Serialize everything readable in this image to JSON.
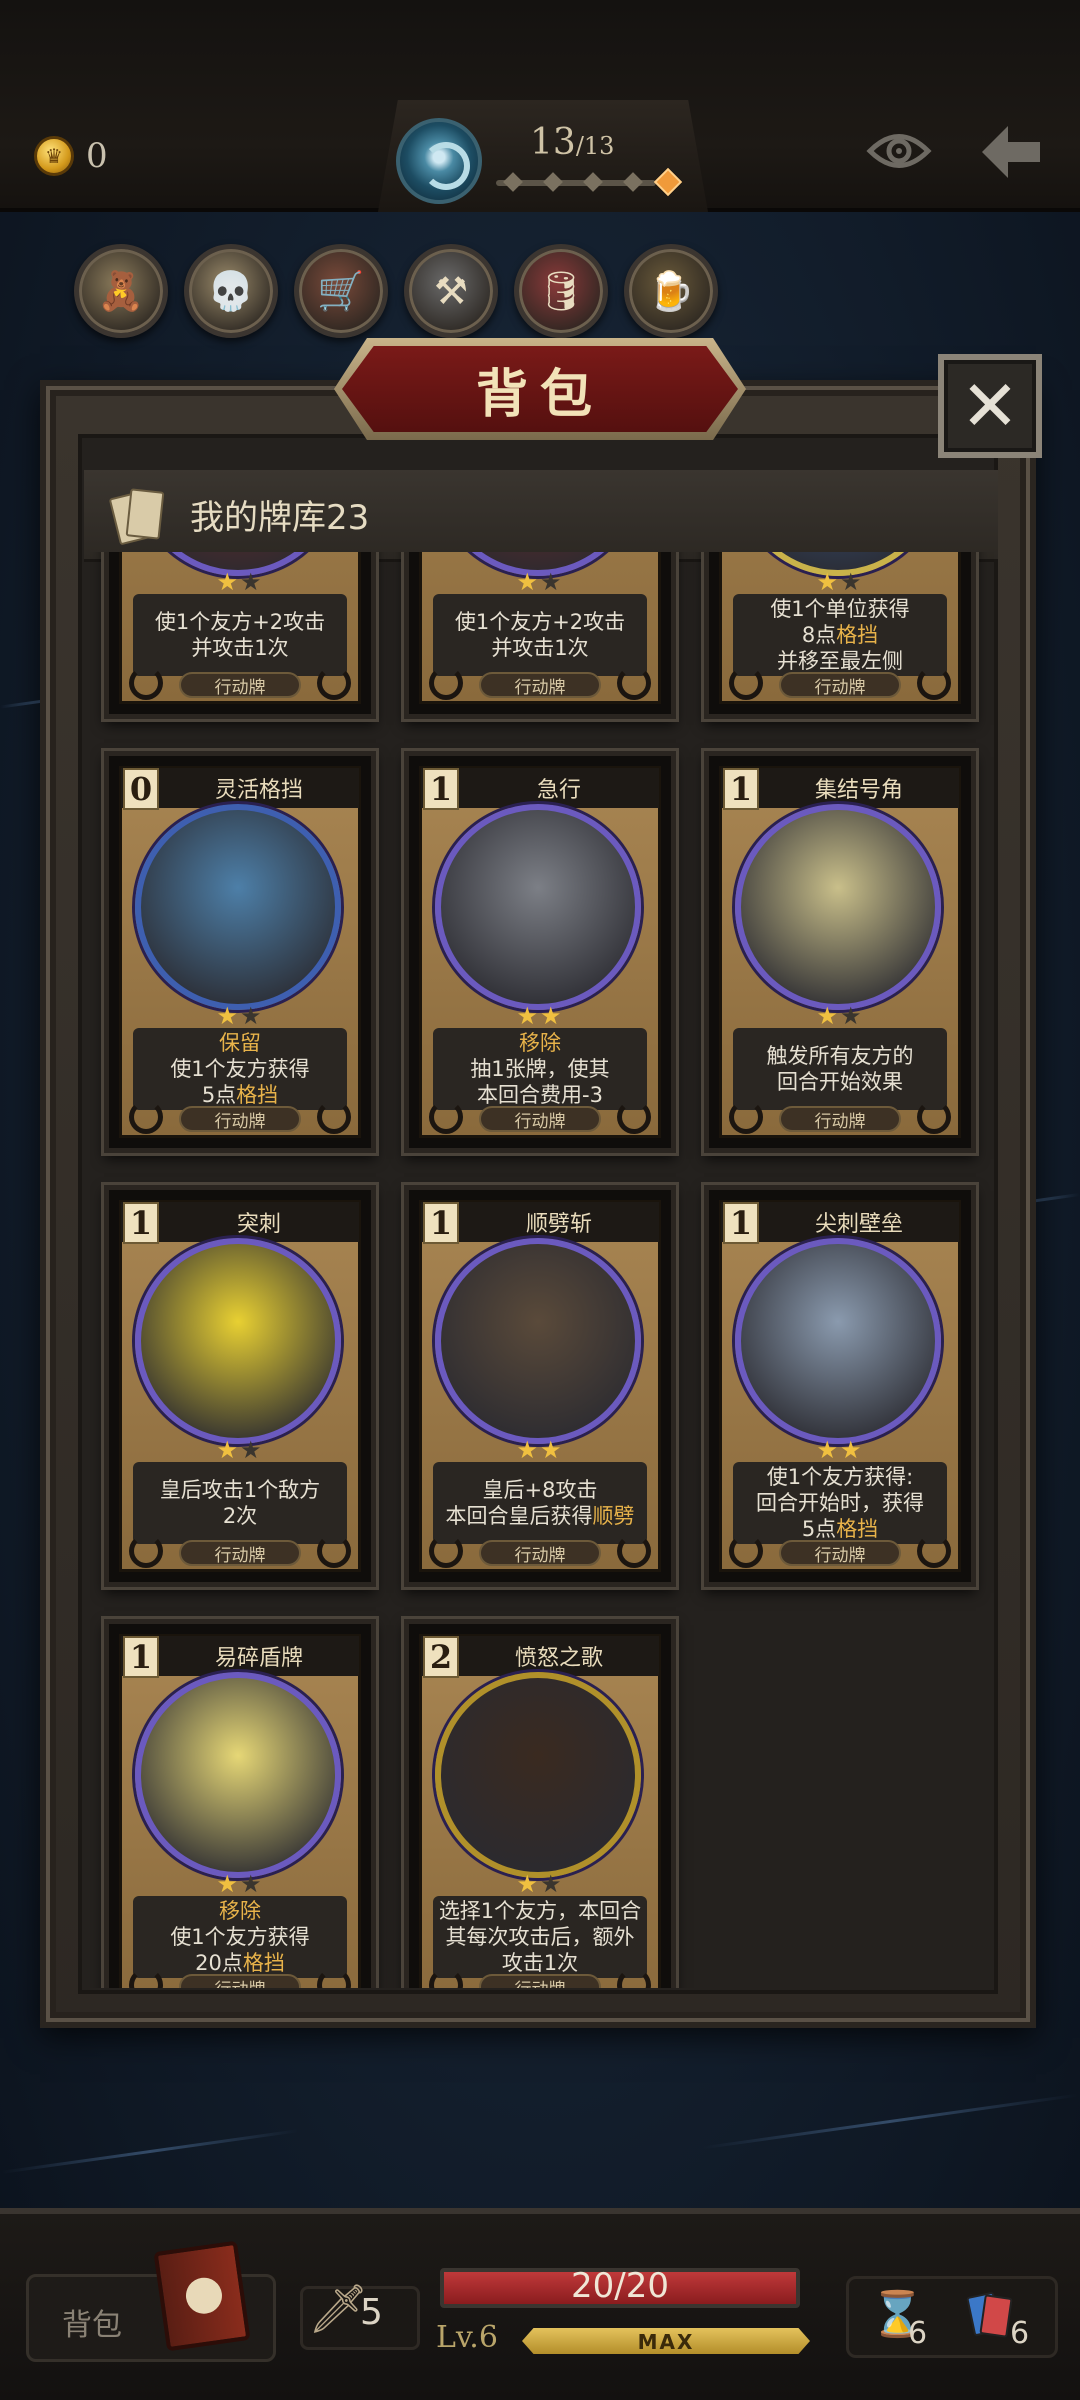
{
  "top_bar": {
    "gold": "0",
    "stage_current": "13",
    "stage_total": "/13",
    "stage_progress": 1.0
  },
  "relics": [
    {
      "name": "relic-scarecrow",
      "glyph": "🧸"
    },
    {
      "name": "relic-skeleton",
      "glyph": "💀"
    },
    {
      "name": "relic-wagon",
      "glyph": "🛒"
    },
    {
      "name": "relic-anvil",
      "glyph": "⚒"
    },
    {
      "name": "relic-barrels",
      "glyph": "🛢"
    },
    {
      "name": "relic-cauldron",
      "glyph": "🍺"
    }
  ],
  "panel": {
    "title": "背包",
    "close_label": "✕",
    "deck_title": "我的牌库23"
  },
  "cards": [
    {
      "cost": "",
      "name": "",
      "stars": 1,
      "lines": [
        "使1个友方+2攻击",
        "并攻击1次"
      ],
      "keyword": "",
      "type": "行动牌",
      "ring": "#6b5abf",
      "art": "#7a2a24"
    },
    {
      "cost": "",
      "name": "",
      "stars": 1,
      "lines": [
        "使1个友方+2攻击",
        "并攻击1次"
      ],
      "keyword": "",
      "type": "行动牌",
      "ring": "#6b5abf",
      "art": "#7a2a24"
    },
    {
      "cost": "",
      "name": "",
      "stars": 1,
      "lines": [
        "使1个单位获得",
        "8点格挡",
        "并移至最左侧"
      ],
      "keyword": "",
      "type": "行动牌",
      "ring": "#c9b24a",
      "art": "#3a5a8a"
    },
    {
      "cost": "0",
      "name": "灵活格挡",
      "stars": 1,
      "keyword": "保留",
      "lines": [
        "使1个友方获得",
        "5点格挡"
      ],
      "type": "行动牌",
      "ring": "#3e5fb0",
      "art": "#4d7fa8"
    },
    {
      "cost": "1",
      "name": "急行",
      "stars": 2,
      "keyword": "移除",
      "lines": [
        "抽1张牌，使其",
        "本回合费用-3"
      ],
      "type": "行动牌",
      "ring": "#6b5abf",
      "art": "#7c7f86"
    },
    {
      "cost": "1",
      "name": "集结号角",
      "stars": 1,
      "keyword": "",
      "lines": [
        "触发所有友方的",
        "回合开始效果"
      ],
      "type": "行动牌",
      "ring": "#6b5abf",
      "art": "#c9bf8a"
    },
    {
      "cost": "1",
      "name": "突刺",
      "stars": 1,
      "keyword": "",
      "lines": [
        "皇后攻击1个敌方",
        "2次"
      ],
      "type": "行动牌",
      "ring": "#6b5abf",
      "art": "#e8d032"
    },
    {
      "cost": "1",
      "name": "顺劈斩",
      "stars": 2,
      "keyword": "",
      "lines": [
        "皇后+8攻击",
        "本回合皇后获得顺劈"
      ],
      "type": "行动牌",
      "ring": "#6b5abf",
      "art": "#5a4a3a"
    },
    {
      "cost": "1",
      "name": "尖刺壁垒",
      "stars": 2,
      "keyword": "",
      "lines": [
        "使1个友方获得:",
        "回合开始时，获得",
        "5点格挡"
      ],
      "type": "行动牌",
      "ring": "#6b5abf",
      "art": "#8a9aae"
    },
    {
      "cost": "1",
      "name": "易碎盾牌",
      "stars": 1,
      "keyword": "移除",
      "lines": [
        "使1个友方获得",
        "20点格挡"
      ],
      "type": "行动牌",
      "ring": "#6b5abf",
      "art": "#e6d776"
    },
    {
      "cost": "2",
      "name": "愤怒之歌",
      "stars": 1,
      "keyword": "",
      "lines": [
        "选择1个友方，本回合",
        "其每次攻击后，额外",
        "攻击1次"
      ],
      "type": "行动牌",
      "ring": "#b0902a",
      "art": "#3a2a20"
    }
  ],
  "bottom_bar": {
    "bag_label": "背包",
    "attack": "5",
    "hp": "20/20",
    "hp_fraction": 1.0,
    "level": "Lv.6",
    "xp_label": "MAX",
    "draw_pile": "6",
    "hand_count": "6"
  },
  "colors": {
    "accent_gold": "#e8b34a",
    "banner_red": "#7a1a18",
    "hp_red": "#c0393a"
  }
}
